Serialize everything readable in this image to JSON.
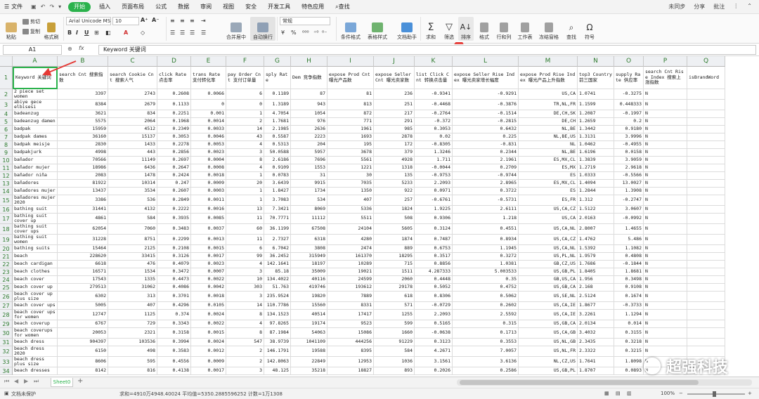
{
  "menu": {
    "file": "文件",
    "tabs": [
      "开始",
      "插入",
      "页面布局",
      "公式",
      "数据",
      "审阅",
      "视图",
      "安全",
      "开发工具",
      "特色应用"
    ],
    "active_tab": "开始",
    "search": "查找",
    "right": [
      "未同步",
      "分享",
      "批注"
    ]
  },
  "ribbon": {
    "paste": "粘贴",
    "cut": "剪切",
    "copy": "复制",
    "format_painter": "格式刷",
    "font_name": "Arial Unicode MS",
    "font_size": "10",
    "merge_center": "合并居中",
    "wrap_text": "自动换行",
    "number_format": "常规",
    "conditional_format": "条件格式",
    "table_style": "表格样式",
    "doc_helper": "文档助手",
    "sum": "求和",
    "filter": "筛选",
    "sort": "排序",
    "format": "格式",
    "row_col": "行和列",
    "worksheet": "工作表",
    "freeze": "冻结窗格",
    "find": "查找",
    "symbol": "符号"
  },
  "formula_bar": {
    "name_box": "A1",
    "fx": "fx",
    "content": "Keyword  关键词"
  },
  "columns": [
    "A",
    "B",
    "C",
    "D",
    "E",
    "F",
    "G",
    "H",
    "I",
    "J",
    "K",
    "L",
    "M",
    "N",
    "O",
    "P",
    "Q"
  ],
  "header_row": [
    "Keyword  关键词",
    "search Cnt 搜索指数",
    "search Cookie Cnt 搜索人气",
    "click Rate 点击率",
    "trans Rate 支付转化率",
    "pay Order Cnt 支付订单量",
    "sply Rate",
    "Dem 竞争指数",
    "expose Prod Cnt 曝光产品数",
    "expose Seller Cnt 曝光卖家数",
    "list Click Cnt 转换点击量",
    "expose Seller Rise Index 曝光卖家增长幅度",
    "expose Prod Rise Index 曝光产品上升指数",
    "top3 Country 前三国家",
    "supply Rate 供应率",
    "search Cnt Rise Index 搜索上涨指数",
    "isBrandWord"
  ],
  "rows": [
    [
      "2 piece set women",
      "3397",
      "2743",
      "0.2608",
      "0.0066",
      "6",
      "0.1189",
      "87",
      "81",
      "236",
      "-0.9341",
      "-0.9291",
      "US,CA",
      "1.0741",
      "-0.3275",
      "N"
    ],
    [
      "abiye gece elbisesi",
      "8384",
      "2679",
      "0.1133",
      "0",
      "0",
      "1.3189",
      "943",
      "813",
      "251",
      "-0.4468",
      "-0.3876",
      "TR,NL,FR",
      "1.1599",
      "0.448333",
      "N"
    ],
    [
      "badeanzug",
      "3621",
      "834",
      "0.2251",
      "0.001",
      "1",
      "4.7054",
      "1054",
      "872",
      "217",
      "-0.2764",
      "-0.1514",
      "DE,CH,SK",
      "1.2087",
      "-0.1997",
      "N"
    ],
    [
      "badeanzug damen",
      "5575",
      "2064",
      "0.1968",
      "0.0014",
      "2",
      "1.7681",
      "976",
      "771",
      "291",
      "-0.372",
      "-0.2815",
      "DE,CH",
      "1.2659",
      "0.2",
      "N"
    ],
    [
      "badpak",
      "15959",
      "4512",
      "0.2349",
      "0.0033",
      "14",
      "2.1985",
      "2636",
      "1961",
      "985",
      "0.3053",
      "0.6432",
      "NL,BE",
      "1.3442",
      "0.9180",
      "N"
    ],
    [
      "badpak dames",
      "36160",
      "15137",
      "0.3053",
      "0.0046",
      "43",
      "0.5587",
      "2223",
      "1693",
      "2878",
      "0.02",
      "0.225",
      "NL,BE,US",
      "1.3131",
      "3.9996",
      "N"
    ],
    [
      "badpak meisje",
      "2830",
      "1433",
      "0.2278",
      "0.0053",
      "4",
      "0.5313",
      "204",
      "195",
      "172",
      "-0.8305",
      "-0.831",
      "NL",
      "1.0462",
      "-0.4955",
      "N"
    ],
    [
      "badpakjurk",
      "4998",
      "443",
      "0.2856",
      "0.0023",
      "3",
      "50.0588",
      "5957",
      "3678",
      "379",
      "1.3246",
      "0.2344",
      "NL,BE",
      "1.6196",
      "0.0158",
      "N"
    ],
    [
      "bañador",
      "70566",
      "11149",
      "0.2697",
      "0.0004",
      "8",
      "2.6186",
      "7696",
      "5561",
      "4928",
      "1.711",
      "2.1961",
      "ES,MX,CL",
      "1.3839",
      "3.9059",
      "N"
    ],
    [
      "bañador mujer",
      "18986",
      "6436",
      "0.2647",
      "0.0008",
      "4",
      "0.9109",
      "1553",
      "1221",
      "1318",
      "-0.0044",
      "0.2709",
      "ES,MX",
      "1.2719",
      "2.9618",
      "N"
    ],
    [
      "bañador niña",
      "2083",
      "1478",
      "0.2424",
      "0.0018",
      "1",
      "0.0783",
      "31",
      "30",
      "135",
      "-0.9753",
      "-0.9744",
      "ES",
      "1.0333",
      "-0.5566",
      "N"
    ],
    [
      "bañadores",
      "81922",
      "10314",
      "0.247",
      "0.0009",
      "20",
      "3.6439",
      "9915",
      "7035",
      "5233",
      "2.2093",
      "2.8965",
      "ES,MX,CL",
      "1.4094",
      "13.0027",
      "N"
    ],
    [
      "bañadores mujer",
      "13437",
      "3534",
      "0.2607",
      "0.0003",
      "1",
      "1.8427",
      "1734",
      "1350",
      "922",
      "0.0971",
      "0.3722",
      "ES",
      "1.2844",
      "1.3908",
      "N"
    ],
    [
      "bañadores mujer 2020",
      "3386",
      "536",
      "0.2849",
      "0.0011",
      "1",
      "3.7083",
      "534",
      "407",
      "257",
      "-0.6761",
      "-0.5731",
      "ES,FR",
      "1.312",
      "-0.2747",
      "N"
    ],
    [
      "bathing suit",
      "31441",
      "4132",
      "0.2222",
      "0.0016",
      "13",
      "7.3421",
      "8069",
      "5336",
      "1824",
      "1.9225",
      "2.6111",
      "US,CA,CZ",
      "1.5122",
      "3.0607",
      "N"
    ],
    [
      "bathing suit cover up",
      "4861",
      "584",
      "0.3935",
      "0.0085",
      "11",
      "70.7771",
      "11112",
      "5511",
      "508",
      "0.9306",
      "1.218",
      "US,CA",
      "2.0163",
      "-0.0992",
      "N"
    ],
    [
      "bathing suit cover ups",
      "62054",
      "7060",
      "0.3483",
      "0.0037",
      "60",
      "36.1199",
      "67508",
      "24104",
      "5605",
      "0.3124",
      "0.4551",
      "US,CA,NL",
      "2.8007",
      "1.4655",
      "N"
    ],
    [
      "bathing suit women",
      "31228",
      "8751",
      "0.2299",
      "0.0013",
      "11",
      "2.7327",
      "6318",
      "4280",
      "1874",
      "0.7487",
      "0.8934",
      "US,CA,CZ",
      "1.4762",
      "5.486",
      "N"
    ],
    [
      "bathing suits",
      "15464",
      "2125",
      "0.2108",
      "0.0015",
      "6",
      "6.7042",
      "3808",
      "2474",
      "889",
      "0.6753",
      "1.1945",
      "US,CA,NL",
      "1.5392",
      "1.1082",
      "N"
    ],
    [
      "beach",
      "228620",
      "33415",
      "0.3126",
      "0.0017",
      "99",
      "36.2452",
      "315949",
      "161370",
      "18295",
      "0.3517",
      "0.3272",
      "US,PL,NL",
      "1.9579",
      "0.4808",
      "N"
    ],
    [
      "beach cardigan",
      "6618",
      "476",
      "0.4079",
      "0.0023",
      "4",
      "142.1641",
      "18197",
      "10289",
      "715",
      "0.8856",
      "1.0381",
      "GB,CZ,US",
      "1.7686",
      "-0.1844",
      "N"
    ],
    [
      "beach clothes",
      "16571",
      "1534",
      "0.3472",
      "0.0007",
      "3",
      "85.18",
      "35009",
      "19021",
      "1511",
      "4.287333",
      "5.003533",
      "US,GB,PL",
      "1.8405",
      "1.8681",
      "N"
    ],
    [
      "beach cover",
      "17543",
      "1335",
      "0.4473",
      "0.0022",
      "10",
      "134.4022",
      "40116",
      "24599",
      "2060",
      "0.4448",
      "0.35",
      "GB,US,CA",
      "1.956",
      "0.3498",
      "N"
    ],
    [
      "beach cover up",
      "279513",
      "31062",
      "0.4086",
      "0.0042",
      "303",
      "51.763",
      "419746",
      "193612",
      "29178",
      "0.5052",
      "0.4752",
      "US,GB,CA",
      "2.168",
      "0.9108",
      "N"
    ],
    [
      "beach cover up plus size",
      "6302",
      "313",
      "0.3701",
      "0.0018",
      "3",
      "235.9524",
      "19820",
      "7889",
      "618",
      "0.8306",
      "0.5062",
      "US,SE,NL",
      "2.5124",
      "0.1674",
      "N"
    ],
    [
      "beach cover ups",
      "5005",
      "407",
      "0.4296",
      "0.0105",
      "14",
      "110.7786",
      "15560",
      "8331",
      "571",
      "-0.0729",
      "0.2602",
      "US,CA,IE",
      "1.8677",
      "-0.3733",
      "N"
    ],
    [
      "beach cover ups for women",
      "12747",
      "1125",
      "0.374",
      "0.0024",
      "8",
      "134.1523",
      "40514",
      "17417",
      "1255",
      "2.2093",
      "2.5592",
      "US,CA,IE",
      "3.2261",
      "1.1294",
      "N"
    ],
    [
      "beach coverup",
      "6767",
      "729",
      "0.3343",
      "0.0022",
      "4",
      "97.8265",
      "19174",
      "9523",
      "599",
      "0.5165",
      "0.315",
      "US,GB,CA",
      "2.0134",
      "0.014",
      "N"
    ],
    [
      "beach coverups for women",
      "20053",
      "2321",
      "0.3158",
      "0.0015",
      "8",
      "87.1984",
      "54063",
      "15086",
      "1660",
      "-0.0638",
      "0.1713",
      "US,CA,GB",
      "3.4032",
      "0.3155",
      "N"
    ],
    [
      "beach dress",
      "904397",
      "103536",
      "0.3994",
      "0.0024",
      "547",
      "38.9739",
      "1041109",
      "444256",
      "91229",
      "0.3123",
      "0.3553",
      "US,NL,GB",
      "2.3435",
      "0.3218",
      "N"
    ],
    [
      "beach dress 2020",
      "6150",
      "498",
      "0.3583",
      "0.0012",
      "2",
      "146.1791",
      "19588",
      "8395",
      "584",
      "4.2671",
      "7.0057",
      "US,NL,FR",
      "2.3322",
      "0.3215",
      "N"
    ],
    [
      "beach dress plus size",
      "8606",
      "595",
      "0.4556",
      "0.0009",
      "2",
      "142.8063",
      "22849",
      "12953",
      "1036",
      "3.1561",
      "3.6136",
      "NL,CZ,US",
      "1.7641",
      "1.8098",
      "N"
    ],
    [
      "beach dresses",
      "8142",
      "816",
      "0.4138",
      "0.0017",
      "3",
      "48.125",
      "35218",
      "18827",
      "893",
      "0.2026",
      "0.2586",
      "US,GB,PL",
      "1.8707",
      "0.0893",
      "N"
    ]
  ],
  "sheet_tab": "Sheet0",
  "status": {
    "protect": "文档未保护",
    "stats": "求和=4910万4948.40024  平均值=5350.2885596252  计数=1万1308",
    "zoom": "100%"
  },
  "watermark": "超强科技",
  "accent": "#2bb24c",
  "annotation_color": "#e53935"
}
